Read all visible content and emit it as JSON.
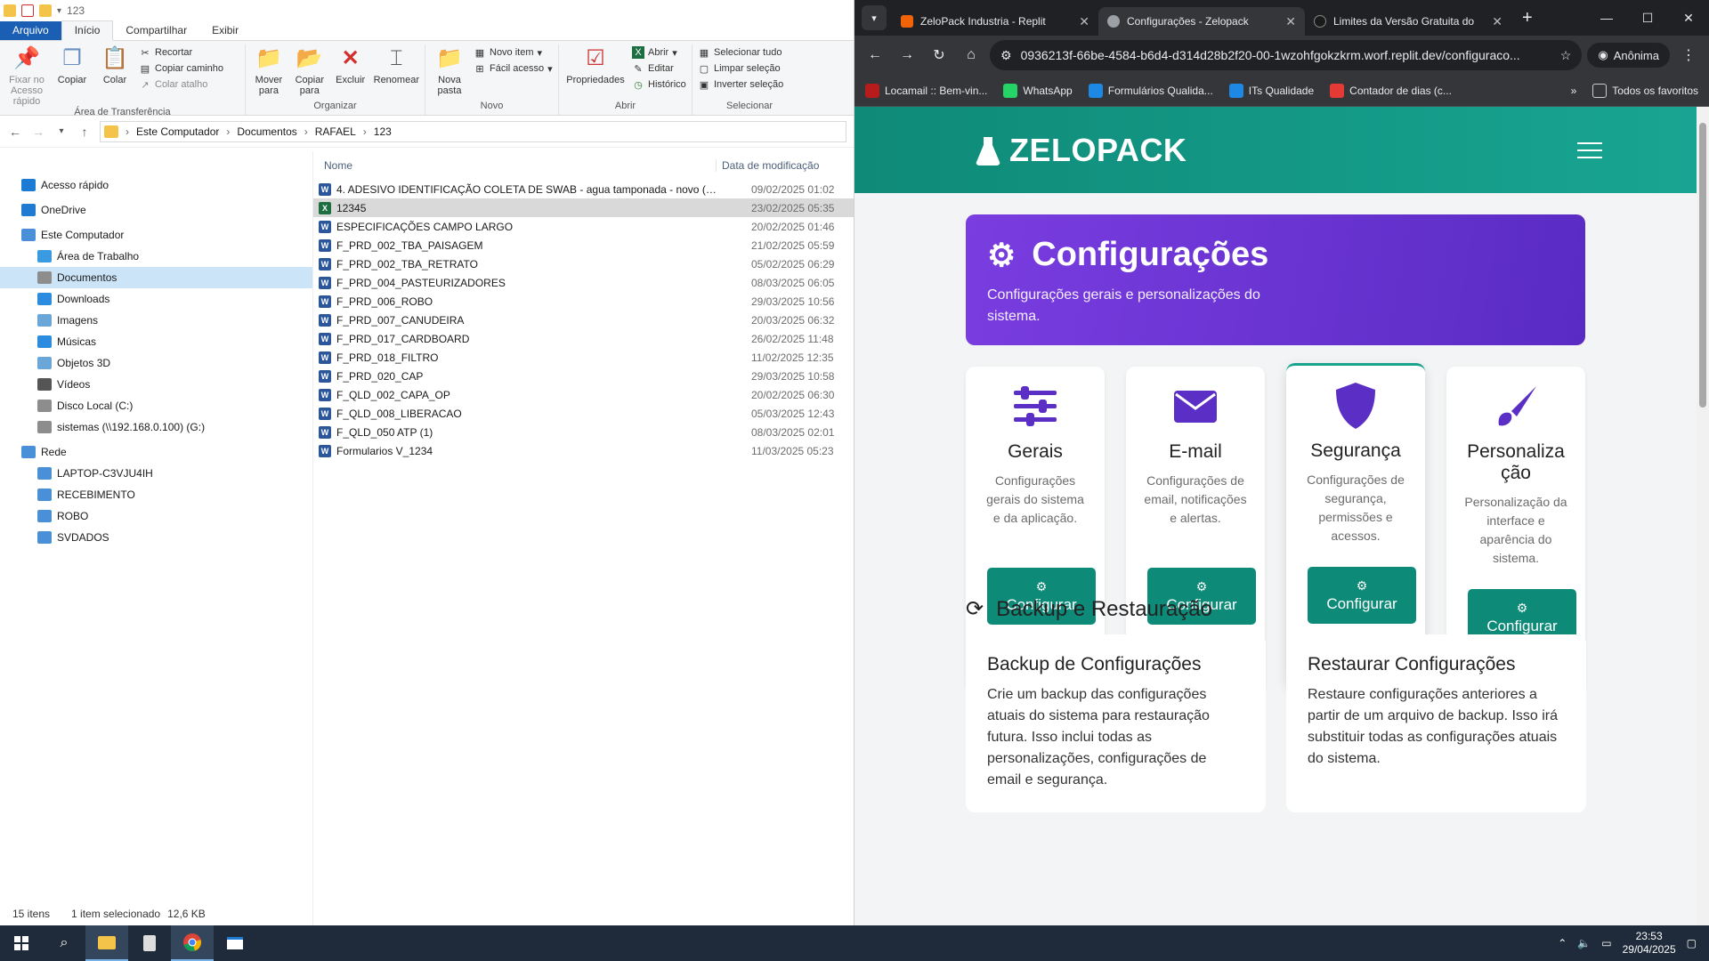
{
  "explorer": {
    "window_title": "123",
    "ribbon_tabs": [
      "Arquivo",
      "Início",
      "Compartilhar",
      "Exibir"
    ],
    "clipboard": {
      "pin_label": "Fixar no Acesso rápido",
      "copy_label": "Copiar",
      "paste_label": "Colar",
      "cut_label": "Recortar",
      "copy_path_label": "Copiar caminho",
      "paste_shortcut_label": "Colar atalho",
      "group_label": "Área de Transferência"
    },
    "organize": {
      "move_label": "Mover para",
      "copy_to_label": "Copiar para",
      "delete_label": "Excluir",
      "rename_label": "Renomear",
      "group_label": "Organizar"
    },
    "new": {
      "new_folder_label": "Nova pasta",
      "new_item_label": "Novo item",
      "easy_access_label": "Fácil acesso",
      "group_label": "Novo"
    },
    "open": {
      "properties_label": "Propriedades",
      "open_label": "Abrir",
      "edit_label": "Editar",
      "history_label": "Histórico",
      "group_label": "Abrir"
    },
    "select": {
      "select_all_label": "Selecionar tudo",
      "clear_label": "Limpar seleção",
      "invert_label": "Inverter seleção",
      "group_label": "Selecionar"
    },
    "breadcrumb": [
      "Este Computador",
      "Documentos",
      "RAFAEL",
      "123"
    ],
    "nav": [
      {
        "label": "Acesso rápido",
        "color": "#1e7bd4"
      },
      {
        "label": "OneDrive",
        "color": "#1e7bd4"
      },
      {
        "label": "Este Computador",
        "color": "#4a90d9"
      },
      {
        "label": "Área de Trabalho",
        "color": "#3a9be0"
      },
      {
        "label": "Documentos",
        "color": "#8d8d8d"
      },
      {
        "label": "Downloads",
        "color": "#2c8ce0"
      },
      {
        "label": "Imagens",
        "color": "#6aa6d8"
      },
      {
        "label": "Músicas",
        "color": "#2c8ce0"
      },
      {
        "label": "Objetos 3D",
        "color": "#6aa6d8"
      },
      {
        "label": "Vídeos",
        "color": "#555555"
      },
      {
        "label": "Disco Local (C:)",
        "color": "#8d8d8d"
      },
      {
        "label": "sistemas (\\\\192.168.0.100) (G:)",
        "color": "#8d8d8d"
      },
      {
        "label": "Rede",
        "color": "#4a90d9"
      },
      {
        "label": "LAPTOP-C3VJU4IH",
        "color": "#4a90d9"
      },
      {
        "label": "RECEBIMENTO",
        "color": "#4a90d9"
      },
      {
        "label": "ROBO",
        "color": "#4a90d9"
      },
      {
        "label": "SVDADOS",
        "color": "#4a90d9"
      }
    ],
    "columns": {
      "name": "Nome",
      "date": "Data de modificação"
    },
    "files": [
      {
        "name": "4. ADESIVO IDENTIFICAÇÃO COLETA DE SWAB - agua tamponada - novo (SE...",
        "date": "09/02/2025 01:02",
        "type": "W"
      },
      {
        "name": "12345",
        "date": "23/02/2025 05:35",
        "type": "X"
      },
      {
        "name": "ESPECIFICAÇÕES CAMPO LARGO",
        "date": "20/02/2025 01:46",
        "type": "W"
      },
      {
        "name": "F_PRD_002_TBA_PAISAGEM",
        "date": "21/02/2025 05:59",
        "type": "W"
      },
      {
        "name": "F_PRD_002_TBA_RETRATO",
        "date": "05/02/2025 06:29",
        "type": "W"
      },
      {
        "name": "F_PRD_004_PASTEURIZADORES",
        "date": "08/03/2025 06:05",
        "type": "W"
      },
      {
        "name": "F_PRD_006_ROBO",
        "date": "29/03/2025 10:56",
        "type": "W"
      },
      {
        "name": "F_PRD_007_CANUDEIRA",
        "date": "20/03/2025 06:32",
        "type": "W"
      },
      {
        "name": "F_PRD_017_CARDBOARD",
        "date": "26/02/2025 11:48",
        "type": "W"
      },
      {
        "name": "F_PRD_018_FILTRO",
        "date": "11/02/2025 12:35",
        "type": "W"
      },
      {
        "name": "F_PRD_020_CAP",
        "date": "29/03/2025 10:58",
        "type": "W"
      },
      {
        "name": "F_QLD_002_CAPA_OP",
        "date": "20/02/2025 06:30",
        "type": "W"
      },
      {
        "name": "F_QLD_008_LIBERACAO",
        "date": "05/03/2025 12:43",
        "type": "W"
      },
      {
        "name": "F_QLD_050 ATP (1)",
        "date": "08/03/2025 02:01",
        "type": "W"
      },
      {
        "name": "Formularios V_1234",
        "date": "11/03/2025 05:23",
        "type": "W"
      }
    ],
    "status": {
      "count": "15 itens",
      "selected": "1 item selecionado",
      "size": "12,6 KB"
    }
  },
  "browser": {
    "tabs": [
      {
        "title": "ZeloPack Industria - Replit",
        "color": "#f26207"
      },
      {
        "title": "Configurações - Zelopack",
        "color": "#9aa0a6"
      },
      {
        "title": "Limites da Versão Gratuita do",
        "color": "#1a1a1a"
      }
    ],
    "url": "0936213f-66be-4584-b6d4-d314d28b2f20-00-1wzohfgokzkrm.worf.replit.dev/configuraco...",
    "profile_label": "Anônima",
    "bookmarks": [
      {
        "label": "Locamail :: Bem-vin...",
        "color": "#b71c1c"
      },
      {
        "label": "WhatsApp",
        "color": "#25d366"
      },
      {
        "label": "Formulários Qualida...",
        "color": "#1e88e5"
      },
      {
        "label": "ITs Qualidade",
        "color": "#1e88e5"
      },
      {
        "label": "Contador de dias (c...",
        "color": "#e53935"
      }
    ],
    "all_bookmarks_label": "Todos os favoritos"
  },
  "app": {
    "brand": "ZELOPACK",
    "hero_title": "Configurações",
    "hero_subtitle": "Configurações gerais e personalizações do sistema.",
    "cards": [
      {
        "title": "Gerais",
        "desc": "Configurações gerais do sistema e da aplicação.",
        "button": "Configurar",
        "icon": "sliders-icon"
      },
      {
        "title": "E-mail",
        "desc": "Configurações de email, notificações e alertas.",
        "button": "Configurar",
        "icon": "envelope-icon"
      },
      {
        "title": "Segurança",
        "desc": "Configurações de segurança, permissões e acessos.",
        "button": "Configurar",
        "icon": "shield-icon"
      },
      {
        "title": "Personalização",
        "desc": "Personalização da interface e aparência do sistema.",
        "button": "Configurar",
        "icon": "paintbrush-icon"
      }
    ],
    "backup_section_title": "Backup e Restauração",
    "backup_card": {
      "title": "Backup de Configurações",
      "desc": "Crie um backup das configurações atuais do sistema para restauração futura. Isso inclui todas as personalizações, configurações de email e segurança."
    },
    "restore_card": {
      "title": "Restaurar Configurações",
      "desc": "Restaure configurações anteriores a partir de um arquivo de backup. Isso irá substituir todas as configurações atuais do sistema."
    },
    "colors": {
      "teal": "#17a38e",
      "purple": "#6a35d6",
      "button": "#0e8a78"
    }
  },
  "taskbar": {
    "time": "23:53",
    "date": "29/04/2025"
  }
}
